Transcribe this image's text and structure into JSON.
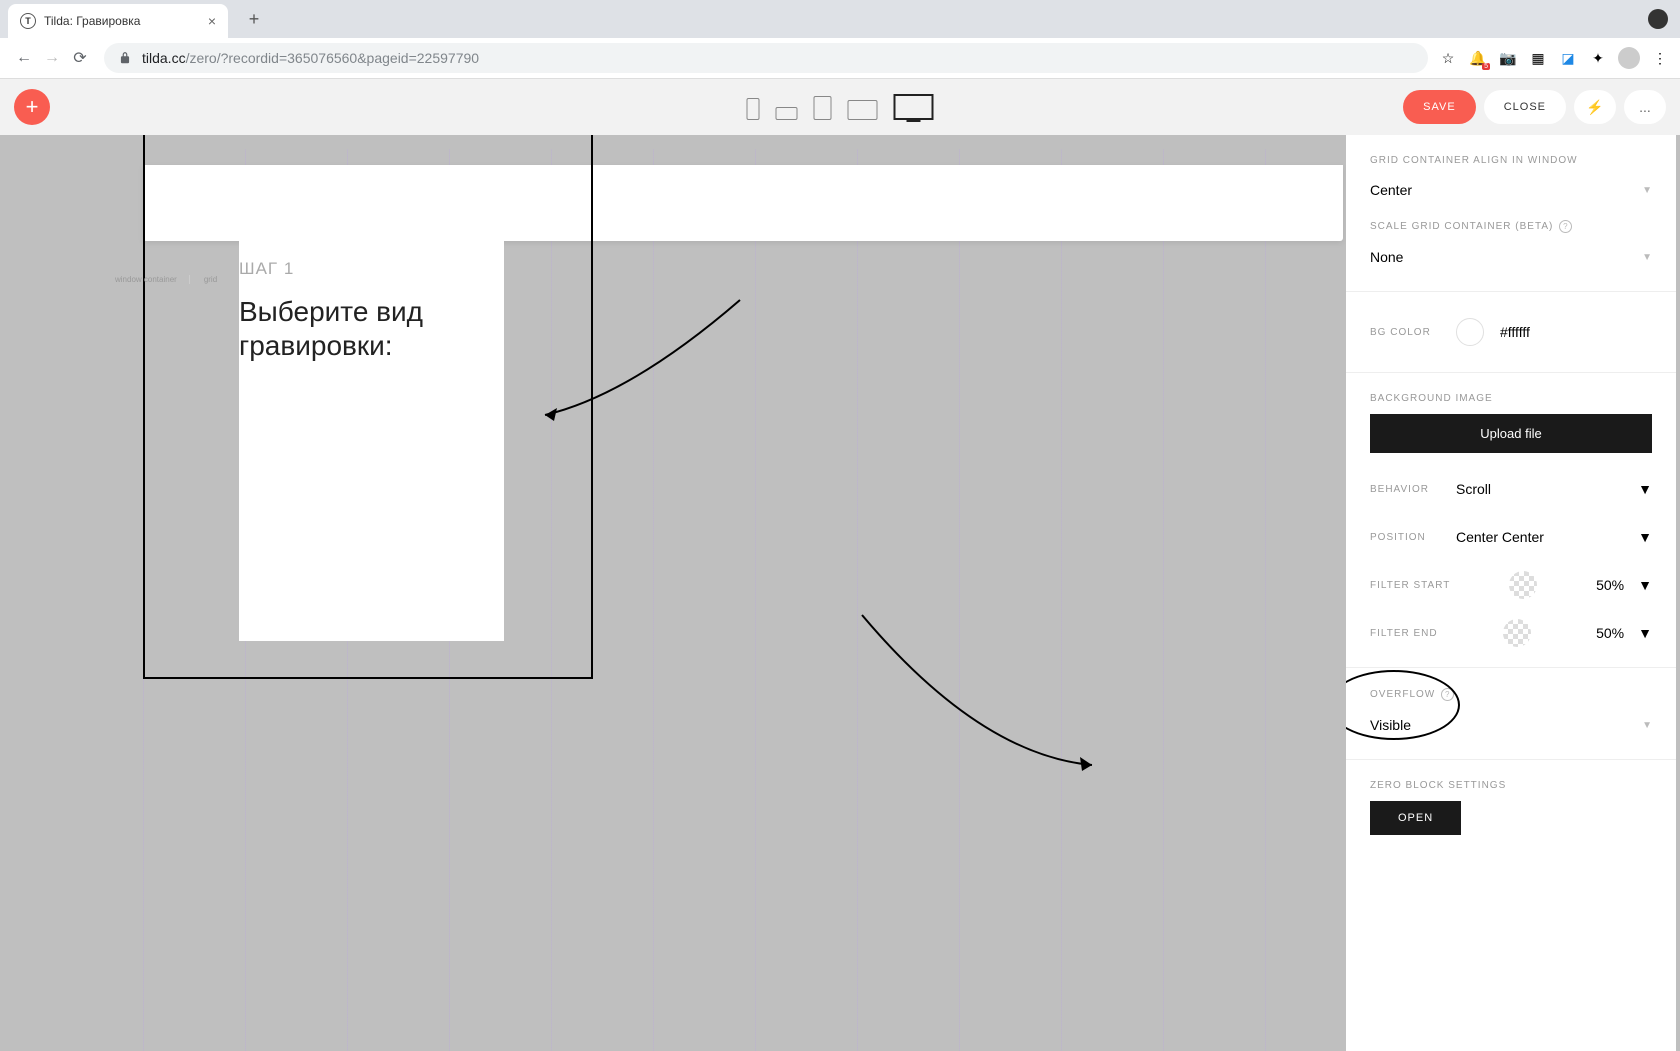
{
  "browser": {
    "tab_title": "Tilda: Гравировка",
    "url_host": "tilda.cc",
    "url_path": "/zero/?recordid=365076560&pageid=22597790"
  },
  "toolbar": {
    "save": "SAVE",
    "close": "CLOSE",
    "lightning": "⚡",
    "more": "..."
  },
  "canvas": {
    "step_label": "ШАГ 1",
    "heading": "Выберите вид гравировки:",
    "ctx_window": "window container",
    "ctx_grid": "grid"
  },
  "panel": {
    "grid_align_label": "GRID CONTAINER ALIGN IN WINDOW",
    "grid_align_value": "Center",
    "scale_label": "SCALE GRID CONTAINER (BETA)",
    "scale_value": "None",
    "bgcolor_label": "BG COLOR",
    "bgcolor_value": "#ffffff",
    "bgimage_label": "BACKGROUND IMAGE",
    "upload_label": "Upload file",
    "behavior_label": "BEHAVIOR",
    "behavior_value": "Scroll",
    "position_label": "POSITION",
    "position_value": "Center Center",
    "filter_start_label": "FILTER START",
    "filter_start_value": "50%",
    "filter_end_label": "FILTER END",
    "filter_end_value": "50%",
    "overflow_label": "OVERFLOW",
    "overflow_value": "Visible",
    "zero_label": "ZERO BLOCK SETTINGS",
    "open_label": "OPEN"
  }
}
